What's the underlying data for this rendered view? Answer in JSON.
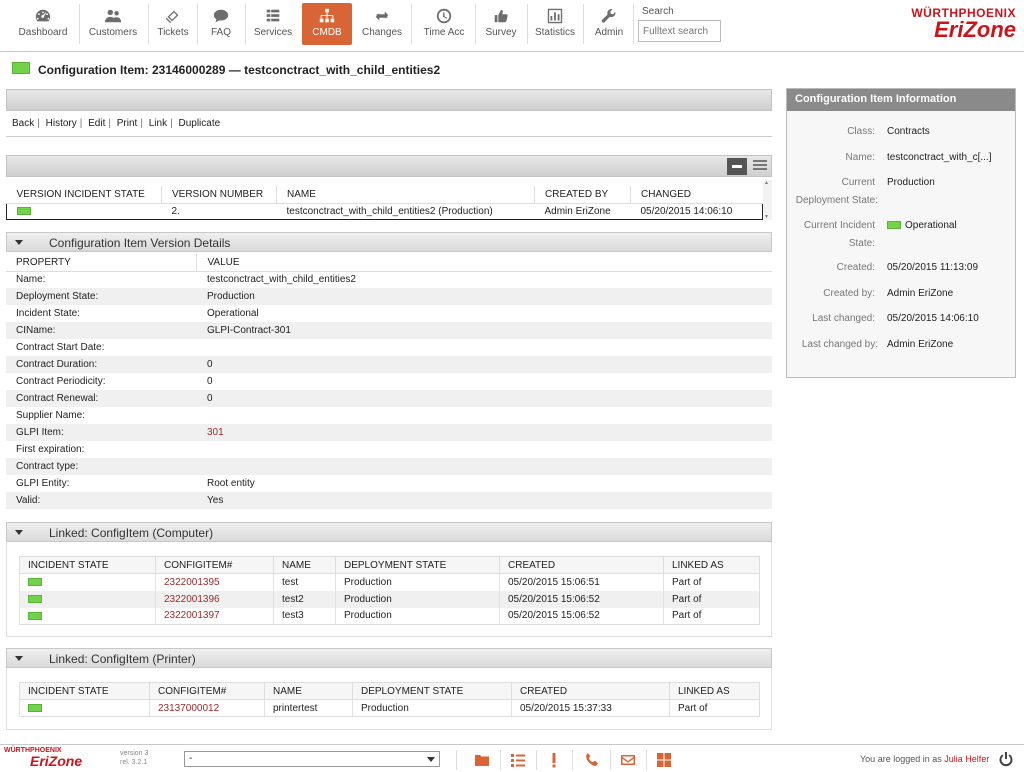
{
  "nav": {
    "items": [
      {
        "label": "Dashboard",
        "icon": "dashboard-icon"
      },
      {
        "label": "Customers",
        "icon": "customers-icon"
      },
      {
        "label": "Tickets",
        "icon": "tickets-icon"
      },
      {
        "label": "FAQ",
        "icon": "faq-icon"
      },
      {
        "label": "Services",
        "icon": "services-icon"
      },
      {
        "label": "CMDB",
        "icon": "cmdb-icon",
        "active": true
      },
      {
        "label": "Changes",
        "icon": "changes-icon"
      },
      {
        "label": "Time Acc",
        "icon": "time-acc-icon"
      },
      {
        "label": "Survey",
        "icon": "survey-icon"
      },
      {
        "label": "Statistics",
        "icon": "statistics-icon"
      },
      {
        "label": "Admin",
        "icon": "admin-icon"
      }
    ],
    "search_label": "Search",
    "search_placeholder": "Fulltext search",
    "logo_top": "WÜRTHPHOENIX",
    "logo_bottom": "EriZone"
  },
  "colors": {
    "accent": "#d96536",
    "brand_red": "#c9141c",
    "state_operational": "#72d24a"
  },
  "page": {
    "title": "Configuration Item: 23146000289 — testconctract_with_child_entities2"
  },
  "actions": [
    "Back",
    "History",
    "Edit",
    "Print",
    "Link",
    "Duplicate"
  ],
  "versions": {
    "headers": [
      "VERSION INCIDENT STATE",
      "VERSION NUMBER",
      "NAME",
      "CREATED BY",
      "CHANGED"
    ],
    "rows": [
      {
        "number": "2.",
        "name": "testconctract_with_child_entities2 (Production)",
        "created_by": "Admin EriZone",
        "changed": "05/20/2015 14:06:10"
      }
    ]
  },
  "details": {
    "title": "Configuration Item Version Details",
    "headers": [
      "PROPERTY",
      "VALUE"
    ],
    "rows": [
      {
        "property": "Name:",
        "value": "testconctract_with_child_entities2"
      },
      {
        "property": "Deployment State:",
        "value": "Production"
      },
      {
        "property": "Incident State:",
        "value": "Operational"
      },
      {
        "property": "CIName:",
        "value": "GLPI-Contract-301"
      },
      {
        "property": "Contract Start Date:",
        "value": ""
      },
      {
        "property": "Contract Duration:",
        "value": "0"
      },
      {
        "property": "Contract Periodicity:",
        "value": "0"
      },
      {
        "property": "Contract Renewal:",
        "value": "0"
      },
      {
        "property": "Supplier Name:",
        "value": ""
      },
      {
        "property": "GLPI Item:",
        "value": "301"
      },
      {
        "property": "First expiration:",
        "value": ""
      },
      {
        "property": "Contract type:",
        "value": ""
      },
      {
        "property": "GLPI Entity:",
        "value": "Root entity"
      },
      {
        "property": "Valid:",
        "value": "Yes"
      }
    ]
  },
  "linked_computer": {
    "title": "Linked: ConfigItem (Computer)",
    "headers": [
      "INCIDENT STATE",
      "CONFIGITEM#",
      "NAME",
      "DEPLOYMENT STATE",
      "CREATED",
      "LINKED AS"
    ],
    "rows": [
      {
        "configitem": "2322001395",
        "name": "test",
        "deployment": "Production",
        "created": "05/20/2015 15:06:51",
        "linked_as": "Part of"
      },
      {
        "configitem": "2322001396",
        "name": "test2",
        "deployment": "Production",
        "created": "05/20/2015 15:06:52",
        "linked_as": "Part of"
      },
      {
        "configitem": "2322001397",
        "name": "test3",
        "deployment": "Production",
        "created": "05/20/2015 15:06:52",
        "linked_as": "Part of"
      }
    ]
  },
  "linked_printer": {
    "title": "Linked: ConfigItem (Printer)",
    "headers": [
      "INCIDENT STATE",
      "CONFIGITEM#",
      "NAME",
      "DEPLOYMENT STATE",
      "CREATED",
      "LINKED AS"
    ],
    "rows": [
      {
        "configitem": "23137000012",
        "name": "printertest",
        "deployment": "Production",
        "created": "05/20/2015 15:37:33",
        "linked_as": "Part of"
      }
    ]
  },
  "info": {
    "title": "Configuration Item Information",
    "class_label": "Class:",
    "class_value": "Contracts",
    "name_label": "Name:",
    "name_value": "testconctract_with_c[...]",
    "deploy_label_1": "Current",
    "deploy_label_2": "Deployment State:",
    "deploy_value": "Production",
    "incident_label_1": "Current Incident",
    "incident_label_2": "State:",
    "incident_value": "Operational",
    "created_label": "Created:",
    "created_value": "05/20/2015 11:13:09",
    "created_by_label": "Created by:",
    "created_by_value": "Admin EriZone",
    "last_changed_label": "Last changed:",
    "last_changed_value": "05/20/2015 14:06:10",
    "last_changed_by_label": "Last changed by:",
    "last_changed_by_value": "Admin EriZone"
  },
  "footer": {
    "logo_top": "WÜRTHPHOENIX",
    "logo_bottom": "EriZone",
    "version_1": "version 3",
    "version_2": "rel. 3.2.1",
    "select_value": "-",
    "login_text": "You are logged in as",
    "user": "Julia Helfer"
  }
}
